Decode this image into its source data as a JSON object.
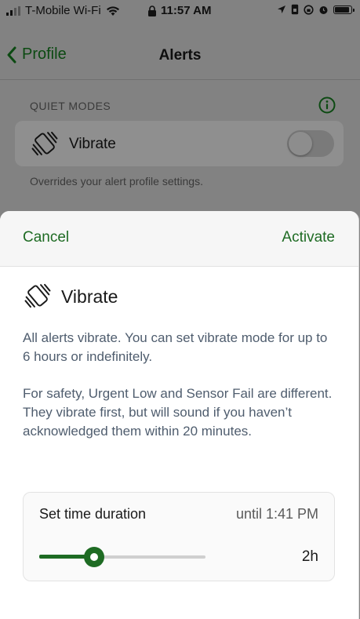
{
  "status_bar": {
    "carrier": "T-Mobile Wi-Fi",
    "time": "11:57 AM"
  },
  "nav": {
    "back_label": "Profile",
    "title": "Alerts"
  },
  "quiet_modes": {
    "section_header": "QUIET MODES",
    "row_label": "Vibrate",
    "toggle_on": false,
    "helper_text": "Overrides your alert profile settings."
  },
  "sheet": {
    "cancel_label": "Cancel",
    "activate_label": "Activate",
    "title": "Vibrate",
    "description_1": "All alerts vibrate. You can set vibrate mode for up to 6 hours or indefinitely.",
    "description_2": "For safety, Urgent Low and Sensor Fail are different. They vibrate first, but will sound if you haven’t acknowledged them within 20 minutes.",
    "duration": {
      "label": "Set time duration",
      "until_text": "until 1:41 PM",
      "value_text": "2h",
      "slider_fraction": 0.33
    }
  },
  "colors": {
    "accent": "#1e6b23",
    "desc_text": "#4f5d6e"
  }
}
